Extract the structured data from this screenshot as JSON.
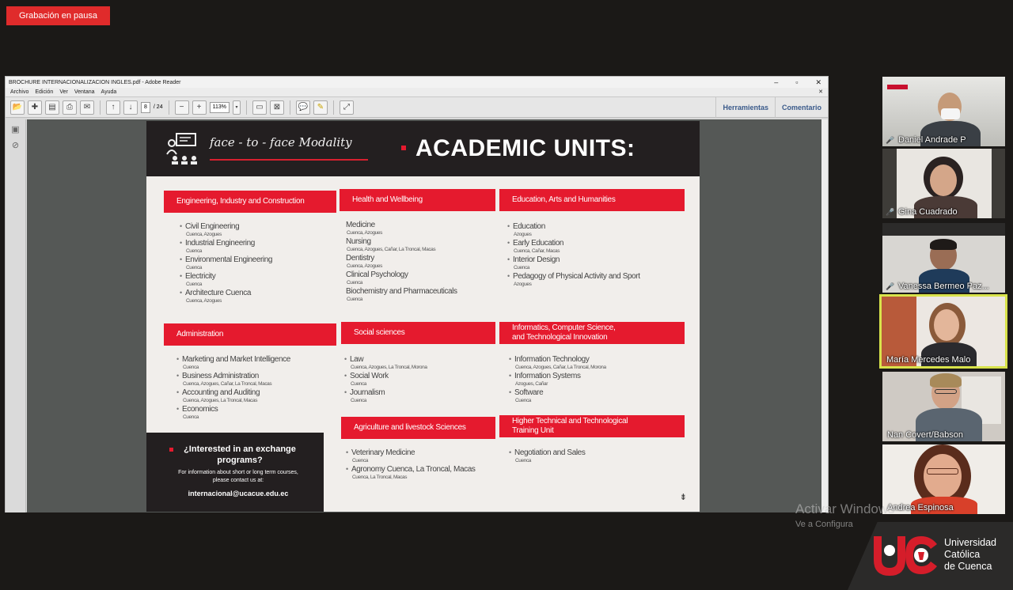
{
  "recording": {
    "label": "Grabación en pausa"
  },
  "reader": {
    "title": "BROCHURE INTERNACIONALIZACION INGLES.pdf - Adobe Reader",
    "controls": {
      "minimize": "–",
      "maximize": "▫",
      "close": "✕"
    },
    "menu": [
      "Archivo",
      "Edición",
      "Ver",
      "Ventana",
      "Ayuda"
    ],
    "menu_close": "✕",
    "toolbar": {
      "page_current": "8",
      "page_total": "/ 24",
      "zoom": "113%",
      "tools_label": "Herramientas",
      "comment_label": "Comentario"
    }
  },
  "page": {
    "modality": "face - to - face Modality",
    "title": "ACADEMIC UNITS:",
    "units": [
      {
        "name": "Engineering, Industry and Construction",
        "programs": [
          {
            "name": "Civil Engineering",
            "loc": "Cuenca, Azogues"
          },
          {
            "name": "Industrial Engineering",
            "loc": "Cuenca"
          },
          {
            "name": "Environmental Engineering",
            "loc": "Cuenca"
          },
          {
            "name": "Electricity",
            "loc": "Cuenca"
          },
          {
            "name": "Architecture Cuenca",
            "loc": "Cuenca, Azogues"
          }
        ]
      },
      {
        "name": "Health and Wellbeing",
        "programs": [
          {
            "name": "Medicine",
            "loc": "Cuenca, Azogues"
          },
          {
            "name": "Nursing",
            "loc": "Cuenca, Azogues, Cañar, La Troncal, Macas"
          },
          {
            "name": "Dentistry",
            "loc": "Cuenca, Azogues"
          },
          {
            "name": "Clinical Psychology",
            "loc": "Cuenca"
          },
          {
            "name": "Biochemistry and Pharmaceuticals",
            "loc": "Cuenca"
          }
        ]
      },
      {
        "name": "Education, Arts and Humanities",
        "programs": [
          {
            "name": "Education",
            "loc": "Azogues"
          },
          {
            "name": "Early Education",
            "loc": "Cuenca, Cañar, Macas"
          },
          {
            "name": "Interior Design",
            "loc": "Cuenca"
          },
          {
            "name": "Pedagogy of Physical Activity and Sport",
            "loc": "Azogues"
          }
        ]
      },
      {
        "name": "Administration",
        "programs": [
          {
            "name": "Marketing and Market Intelligence",
            "loc": "Cuenca"
          },
          {
            "name": "Business Administration",
            "loc": "Cuenca, Azogues, Cañar, La Troncal, Macas"
          },
          {
            "name": "Accounting and Auditing",
            "loc": "Cuenca, Azogues, La Troncal, Macas"
          },
          {
            "name": "Economics",
            "loc": "Cuenca"
          }
        ]
      },
      {
        "name": "Social sciences",
        "programs": [
          {
            "name": "Law",
            "loc": "Cuenca, Azogues, La Troncal, Morona"
          },
          {
            "name": "Social Work",
            "loc": "Cuenca"
          },
          {
            "name": "Journalism",
            "loc": "Cuenca"
          }
        ]
      },
      {
        "name_line1": "Informatics, Computer Science,",
        "name_line2": "and Technological Innovation",
        "programs": [
          {
            "name": "Information Technology",
            "loc": "Cuenca, Azogues, Cañar, La Troncal, Morona"
          },
          {
            "name": "Information Systems",
            "loc": "Azogues, Cañar"
          },
          {
            "name": "Software",
            "loc": "Cuenca"
          }
        ]
      },
      {
        "name": "Agriculture and livestock Sciences",
        "programs": [
          {
            "name": "Veterinary Medicine",
            "loc": "Cuenca"
          },
          {
            "name": "Agronomy Cuenca, La Troncal, Macas",
            "loc": "Cuenca, La Troncal, Macas"
          }
        ]
      },
      {
        "name_line1": "Higher Technical and Technological",
        "name_line2": "Training Unit",
        "programs": [
          {
            "name": "Negotiation and Sales",
            "loc": "Cuenca"
          }
        ]
      }
    ],
    "exchange": {
      "title": "¿Interested in an exchange programs?",
      "info": "For information about short or long term courses, please contact us at:",
      "email": "internacional@ucacue.edu.ec"
    }
  },
  "participants": [
    {
      "name": "Daniel Andrade P",
      "muted": true
    },
    {
      "name": "Gina Cuadrado",
      "muted": true
    },
    {
      "name": "Vanessa Bermeo Paz...",
      "muted": true
    },
    {
      "name": "María Mercedes Malo",
      "muted": false
    },
    {
      "name": "Nan Covert/Babson",
      "muted": false
    },
    {
      "name": "Andrea Espinosa",
      "muted": false
    }
  ],
  "watermark": {
    "line1": "Activar Windows",
    "line2": "Ve a Configura"
  },
  "logo": {
    "line1": "Universidad",
    "line2": "Católica",
    "line3": "de Cuenca"
  },
  "colors": {
    "accent_red": "#e51a2e",
    "header_dark": "#231f20",
    "page_bg": "#f1eeeb"
  }
}
